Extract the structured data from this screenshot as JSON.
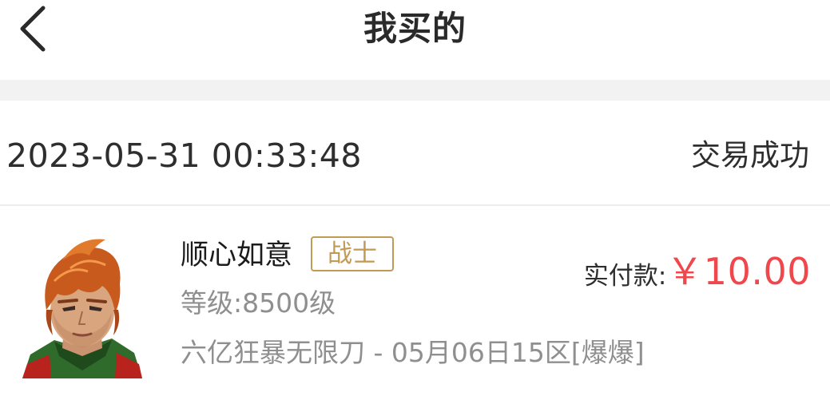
{
  "header": {
    "title": "我买的",
    "back_icon": "chevron-left-icon"
  },
  "order": {
    "time": "2023-05-31 00:33:48",
    "status": "交易成功",
    "item": {
      "avatar": "warrior-avatar",
      "name": "顺心如意",
      "class_badge": "战士",
      "level": "等级:8500级",
      "server": "六亿狂暴无限刀 - 05月06日15区[爆爆]",
      "price_label": "实付款:",
      "price_value": "￥10.00"
    }
  },
  "colors": {
    "price": "#f0474d",
    "badge": "#c19a56",
    "muted": "#8f8f8f",
    "band": "#f2f2f2"
  }
}
